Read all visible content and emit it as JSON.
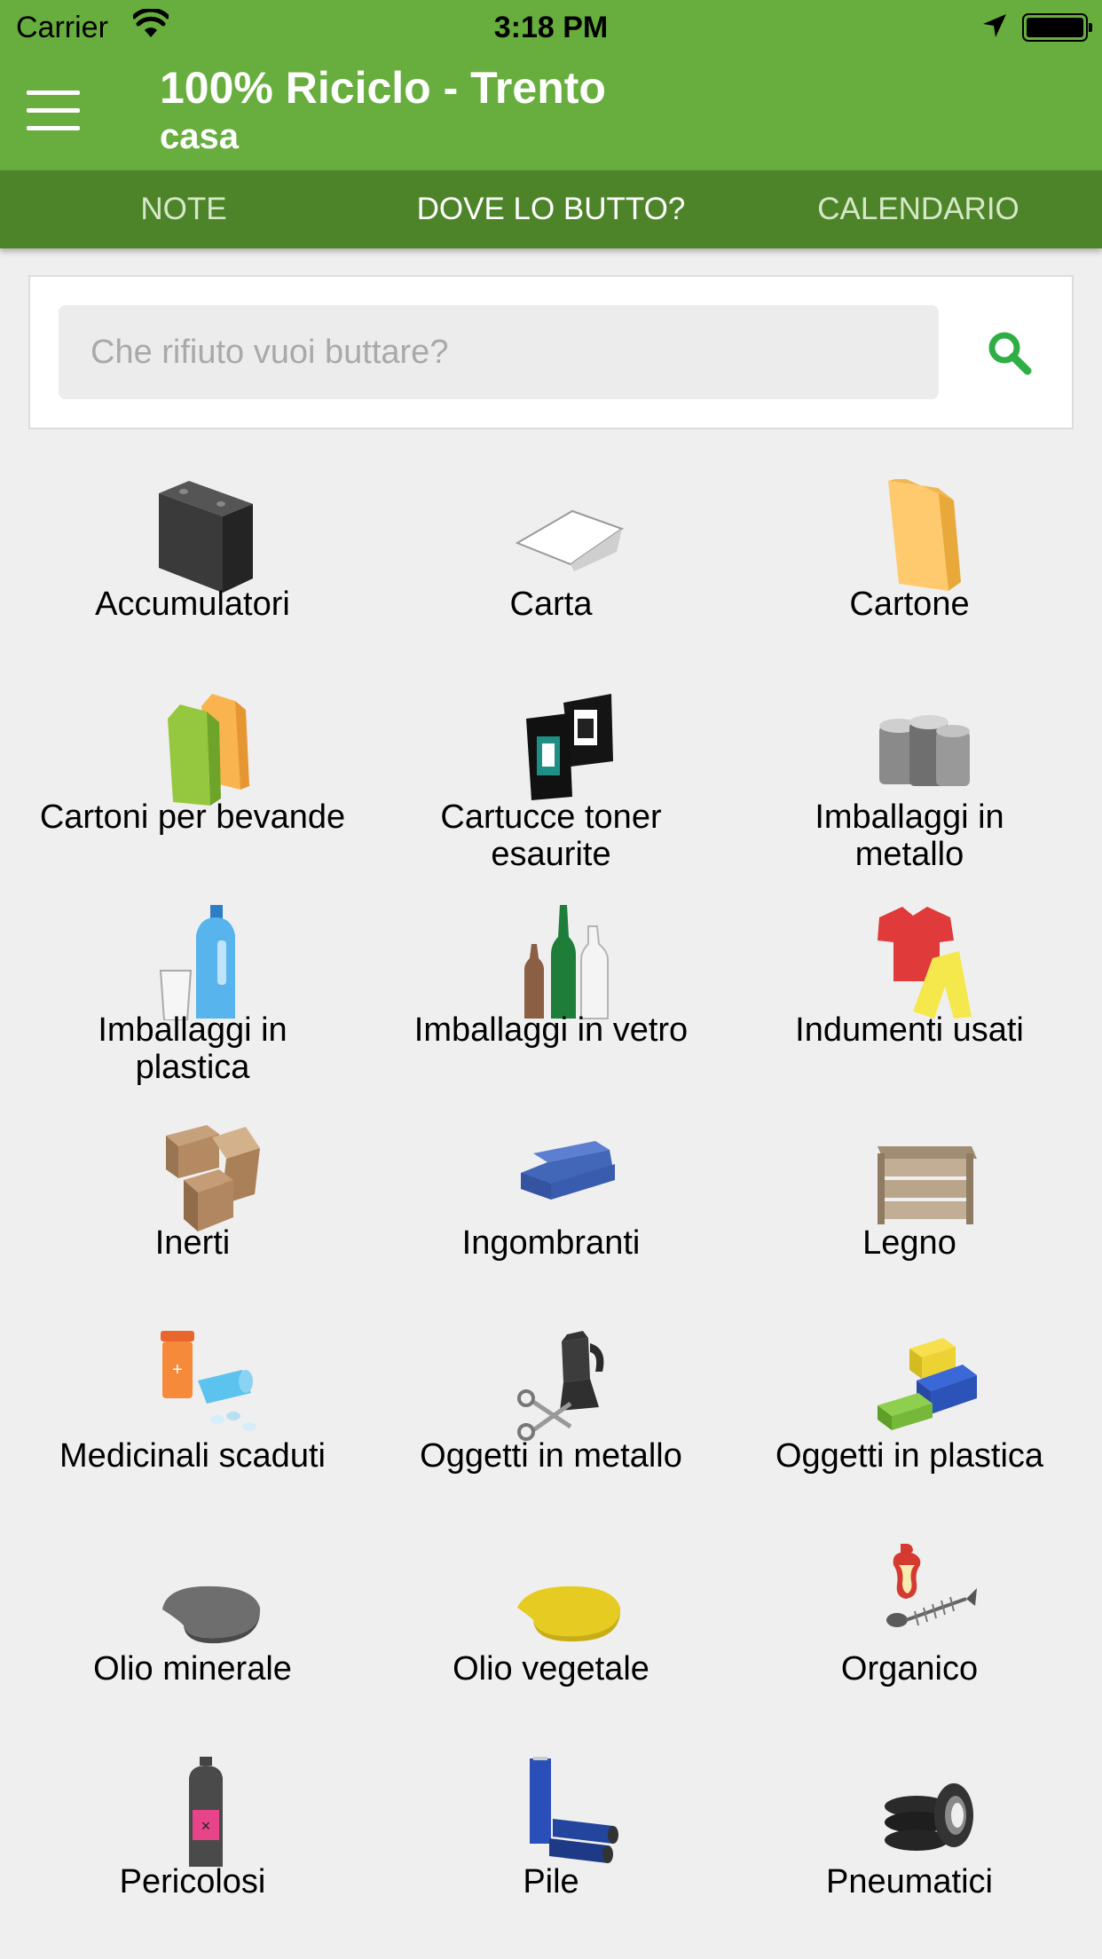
{
  "status_bar": {
    "carrier": "Carrier",
    "time": "3:18 PM"
  },
  "app_bar": {
    "title": "100% Riciclo - Trento",
    "subtitle": "casa"
  },
  "tabs": [
    {
      "label": "NOTE",
      "active": false
    },
    {
      "label": "DOVE LO BUTTO?",
      "active": true
    },
    {
      "label": "CALENDARIO",
      "active": false
    }
  ],
  "search": {
    "placeholder": "Che rifiuto vuoi buttare?",
    "value": ""
  },
  "categories": [
    {
      "label": "Accumulatori",
      "icon": "battery-icon"
    },
    {
      "label": "Carta",
      "icon": "paper-icon"
    },
    {
      "label": "Cartone",
      "icon": "cardboard-bag-icon"
    },
    {
      "label": "Cartoni per bevande",
      "icon": "drink-carton-icon"
    },
    {
      "label": "Cartucce toner esaurite",
      "icon": "ink-cartridge-icon"
    },
    {
      "label": "Imballaggi in metallo",
      "icon": "metal-cans-icon"
    },
    {
      "label": "Imballaggi in plastica",
      "icon": "plastic-bottle-icon"
    },
    {
      "label": "Imballaggi in vetro",
      "icon": "glass-bottles-icon"
    },
    {
      "label": "Indumenti usati",
      "icon": "clothes-icon"
    },
    {
      "label": "Inerti",
      "icon": "bricks-icon"
    },
    {
      "label": "Ingombranti",
      "icon": "sofa-icon"
    },
    {
      "label": "Legno",
      "icon": "wooden-crate-icon"
    },
    {
      "label": "Medicinali scaduti",
      "icon": "medicine-icon"
    },
    {
      "label": "Oggetti in metallo",
      "icon": "moka-scissors-icon"
    },
    {
      "label": "Oggetti in plastica",
      "icon": "toy-bricks-icon"
    },
    {
      "label": "Olio minerale",
      "icon": "mineral-oil-icon"
    },
    {
      "label": "Olio vegetale",
      "icon": "vegetable-oil-icon"
    },
    {
      "label": "Organico",
      "icon": "apple-fishbone-icon"
    },
    {
      "label": "Pericolosi",
      "icon": "spray-can-icon"
    },
    {
      "label": "Pile",
      "icon": "batteries-icon"
    },
    {
      "label": "Pneumatici",
      "icon": "tyres-icon"
    }
  ],
  "colors": {
    "primary": "#67ae3e",
    "primary_dark": "#4e8429",
    "search_icon": "#2fae45"
  }
}
